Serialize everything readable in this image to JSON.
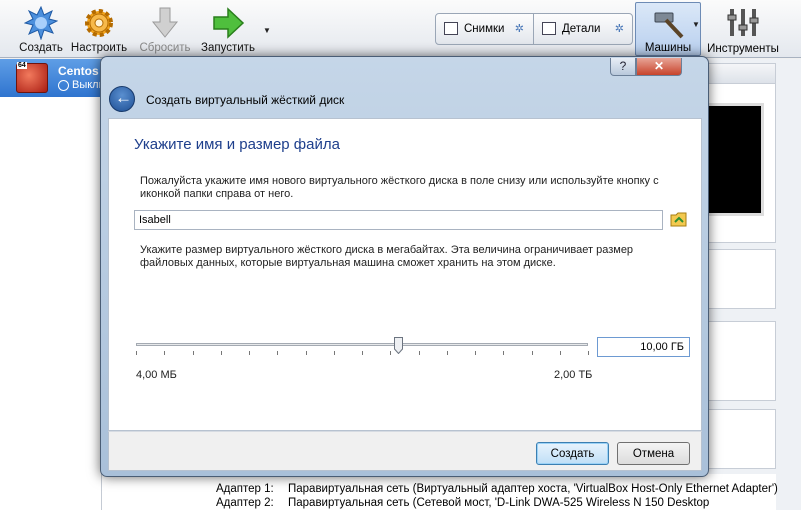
{
  "toolbar": {
    "create_label": "Создать",
    "settings_label": "Настроить",
    "discard_label": "Сбросить",
    "start_label": "Запустить",
    "snapshots_label": "Снимки",
    "details_label": "Детали",
    "machines_label": "Машины",
    "tools_label": "Инструменты"
  },
  "vm_list": {
    "items": [
      {
        "name": "Centos",
        "state": "Выключена",
        "os_badge": "64"
      }
    ]
  },
  "details": {
    "adapters": [
      {
        "key": "Адаптер 1:",
        "value": "Паравиртуальная сеть (Виртуальный адаптер хоста, 'VirtualBox Host-Only Ethernet Adapter')"
      },
      {
        "key": "Адаптер 2:",
        "value": "Паравиртуальная сеть (Сетевой мост, 'D-Link DWA-525 Wireless N 150 Desktop"
      }
    ]
  },
  "dialog": {
    "title": "Создать виртуальный жёсткий диск",
    "help_glyph": "?",
    "close_glyph": "✕",
    "heading": "Укажите имя и размер файла",
    "name_description": "Пожалуйста укажите имя нового виртуального жёсткого диска в поле снизу или используйте кнопку с иконкой папки справа от него.",
    "file_name": "Isabell",
    "size_description": "Укажите размер виртуального жёсткого диска в мегабайтах. Эта величина ограничивает размер файловых данных, которые виртуальная машина сможет хранить на этом диске.",
    "size_value": "10,00 ГБ",
    "size_slider_fraction": 0.58,
    "min_label": "4,00 МБ",
    "max_label": "2,00 ТБ",
    "create_label": "Создать",
    "cancel_label": "Отмена"
  },
  "colors": {
    "heading": "#1e3f8c",
    "selection": "#3b7ed6",
    "close_button": "#c7432b"
  }
}
